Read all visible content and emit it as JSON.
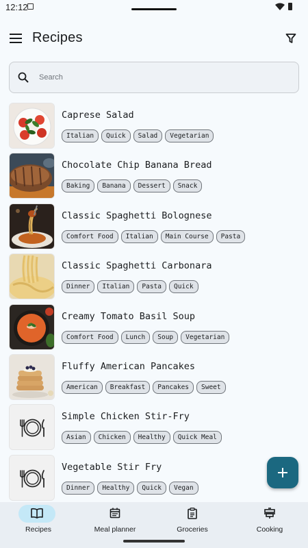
{
  "status": {
    "time": "12:12"
  },
  "header": {
    "title": "Recipes"
  },
  "search": {
    "placeholder": "Search",
    "value": ""
  },
  "recipes": [
    {
      "name": "Caprese Salad",
      "tags": [
        "Italian",
        "Quick",
        "Salad",
        "Vegetarian"
      ]
    },
    {
      "name": "Chocolate Chip Banana Bread",
      "tags": [
        "Baking",
        "Banana",
        "Dessert",
        "Snack"
      ]
    },
    {
      "name": "Classic Spaghetti Bolognese",
      "tags": [
        "Comfort Food",
        "Italian",
        "Main Course",
        "Pasta"
      ]
    },
    {
      "name": "Classic Spaghetti Carbonara",
      "tags": [
        "Dinner",
        "Italian",
        "Pasta",
        "Quick"
      ]
    },
    {
      "name": "Creamy Tomato Basil Soup",
      "tags": [
        "Comfort Food",
        "Lunch",
        "Soup",
        "Vegetarian"
      ]
    },
    {
      "name": "Fluffy American Pancakes",
      "tags": [
        "American",
        "Breakfast",
        "Pancakes",
        "Sweet"
      ]
    },
    {
      "name": "Simple Chicken Stir-Fry",
      "tags": [
        "Asian",
        "Chicken",
        "Healthy",
        "Quick Meal"
      ]
    },
    {
      "name": "Vegetable Stir Fry",
      "tags": [
        "Dinner",
        "Healthy",
        "Quick",
        "Vegan"
      ]
    }
  ],
  "nav": {
    "items": [
      {
        "label": "Recipes",
        "icon": "book-icon"
      },
      {
        "label": "Meal planner",
        "icon": "calendar-icon"
      },
      {
        "label": "Groceries",
        "icon": "clipboard-icon"
      },
      {
        "label": "Cooking",
        "icon": "cooking-pot-icon"
      }
    ]
  },
  "colors": {
    "accent": "#1b6880",
    "active_indicator": "#c4e8f7",
    "background": "#f6fafd"
  }
}
